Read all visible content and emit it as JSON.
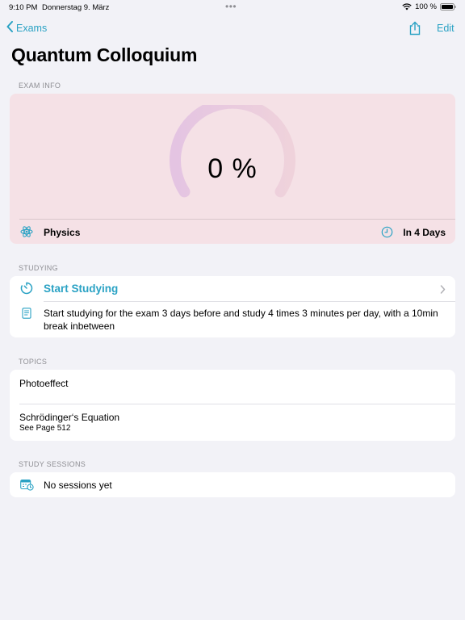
{
  "status_bar": {
    "time": "9:10 PM",
    "date": "Donnerstag 9. März",
    "battery": "100 %"
  },
  "nav": {
    "back_label": "Exams",
    "edit_label": "Edit"
  },
  "title": "Quantum Colloquium",
  "exam_info": {
    "header": "EXAM INFO",
    "progress_text": "0 %",
    "progress_fraction": 0,
    "subject": "Physics",
    "due": "In 4 Days",
    "card_color": "#f5e1e6"
  },
  "studying": {
    "header": "STUDYING",
    "start_label": "Start Studying",
    "description": "Start studying for the exam 3 days before and study 4 times 3 minutes per day, with a 10min break inbetween"
  },
  "topics": {
    "header": "TOPICS",
    "items": [
      {
        "title": "Photoeffect",
        "subtitle": ""
      },
      {
        "title": "Schrödinger‘s Equation",
        "subtitle": "See Page 512"
      }
    ]
  },
  "study_sessions": {
    "header": "STUDY SESSIONS",
    "empty_label": "No sessions yet"
  },
  "colors": {
    "accent": "#2aa2c4",
    "background": "#f2f2f7"
  }
}
